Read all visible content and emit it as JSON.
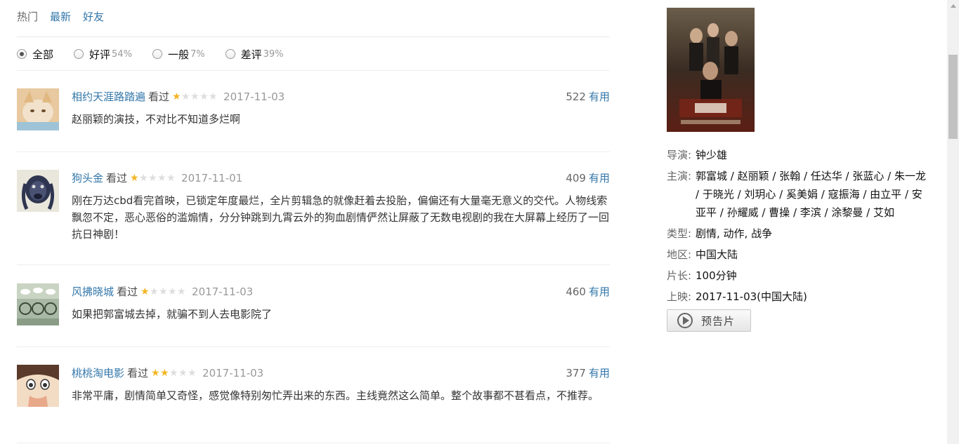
{
  "tabs": [
    {
      "label": "热门"
    },
    {
      "label": "最新"
    },
    {
      "label": "好友"
    }
  ],
  "filters": [
    {
      "label": "全部",
      "pct": "",
      "checked": true
    },
    {
      "label": "好评",
      "pct": "54%",
      "checked": false
    },
    {
      "label": "一般",
      "pct": "7%",
      "checked": false
    },
    {
      "label": "差评",
      "pct": "39%",
      "checked": false
    }
  ],
  "comments": [
    {
      "user": "相约天涯路踏遍",
      "watched": "看过",
      "rating": 1,
      "time": "2017-11-03",
      "votes": "522",
      "useful": "有用",
      "text": "赵丽颖的演技，不对比不知道多烂啊"
    },
    {
      "user": "狗头金",
      "watched": "看过",
      "rating": 1,
      "time": "2017-11-01",
      "votes": "409",
      "useful": "有用",
      "text": "刚在万达cbd看完首映，已锁定年度最烂，全片剪辑急的就像赶着去投胎，偏偏还有大量毫无意义的交代。人物线索飘忽不定，恶心恶俗的滥煽情，分分钟跳到九霄云外的狗血剧情俨然让屏蔽了无数电视剧的我在大屏幕上经历了一回抗日神剧！"
    },
    {
      "user": "风拂晓城",
      "watched": "看过",
      "rating": 1,
      "time": "2017-11-03",
      "votes": "460",
      "useful": "有用",
      "text": "如果把郭富城去掉，就骗不到人去电影院了"
    },
    {
      "user": "桃桃淘电影",
      "watched": "看过",
      "rating": 2,
      "time": "2017-11-03",
      "votes": "377",
      "useful": "有用",
      "text": "非常平庸，剧情简单又奇怪，感觉像特别匆忙弄出来的东西。主线竟然这么简单。整个故事都不甚看点，不推荐。"
    }
  ],
  "movie": {
    "director_label": "导演:",
    "director": "钟少雄",
    "cast_label": "主演:",
    "cast": "郭富城 / 赵丽颖 / 张翰 / 任达华 / 张蓝心 / 朱一龙 / 于晓光 / 刘玥心 / 奚美娟 / 寇振海 / 由立平 / 安亚平 / 孙耀威 / 曹操 / 李滨 / 涂黎曼 / 艾如",
    "genre_label": "类型:",
    "genre": "剧情, 动作, 战争",
    "region_label": "地区:",
    "region": "中国大陆",
    "length_label": "片长:",
    "length": "100分钟",
    "release_label": "上映:",
    "release": "2017-11-03(中国大陆)",
    "trailer_label": "预告片"
  },
  "colors": {
    "link": "#3377aa",
    "star": "#f4b524"
  }
}
